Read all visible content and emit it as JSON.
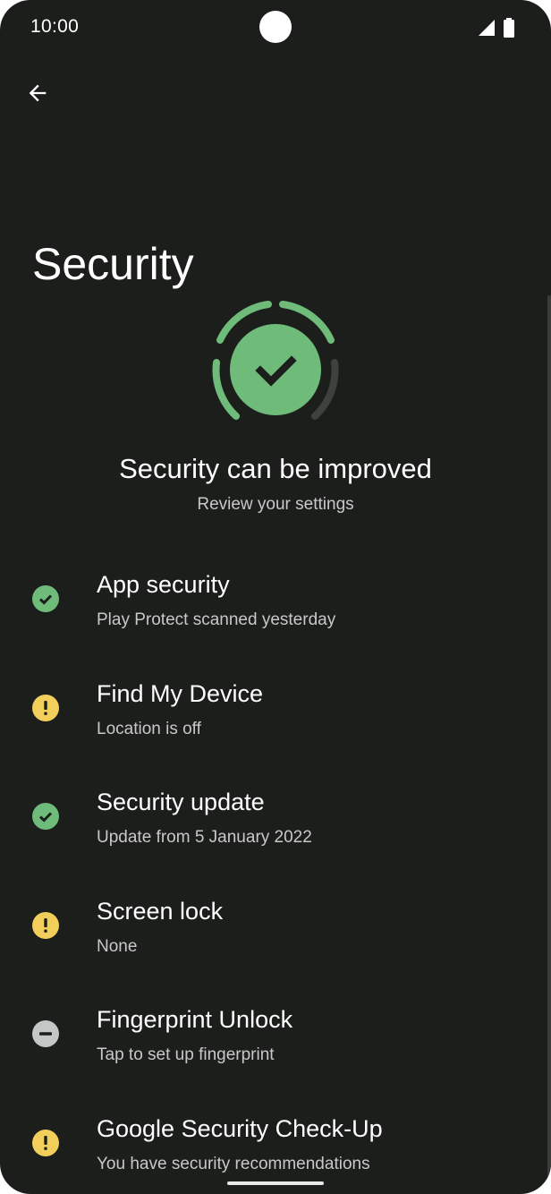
{
  "status_bar": {
    "time": "10:00",
    "icons": [
      "signal-icon",
      "battery-icon"
    ]
  },
  "header": {
    "back_icon": "arrow-back-icon",
    "title": "Security"
  },
  "status": {
    "icon": "check-shield-icon",
    "title": "Security can be improved",
    "subtitle": "Review your settings",
    "color_ok": "#6fbb7a",
    "color_warn": "#f2cf5a"
  },
  "items": [
    {
      "title": "App security",
      "summary": "Play Protect scanned yesterday",
      "status": "ok",
      "icon": "check-circle-icon"
    },
    {
      "title": "Find My Device",
      "summary": "Location is off",
      "status": "warning",
      "icon": "exclamation-circle-icon"
    },
    {
      "title": "Security update",
      "summary": "Update from 5 January 2022",
      "status": "ok",
      "icon": "check-circle-icon"
    },
    {
      "title": "Screen lock",
      "summary": "None",
      "status": "warning",
      "icon": "exclamation-circle-icon"
    },
    {
      "title": "Fingerprint Unlock",
      "summary": "Tap to set up fingerprint",
      "status": "disabled",
      "icon": "minus-circle-icon"
    },
    {
      "title": "Google Security Check-Up",
      "summary": "You have security recommendations",
      "status": "warning",
      "icon": "exclamation-circle-icon"
    }
  ]
}
